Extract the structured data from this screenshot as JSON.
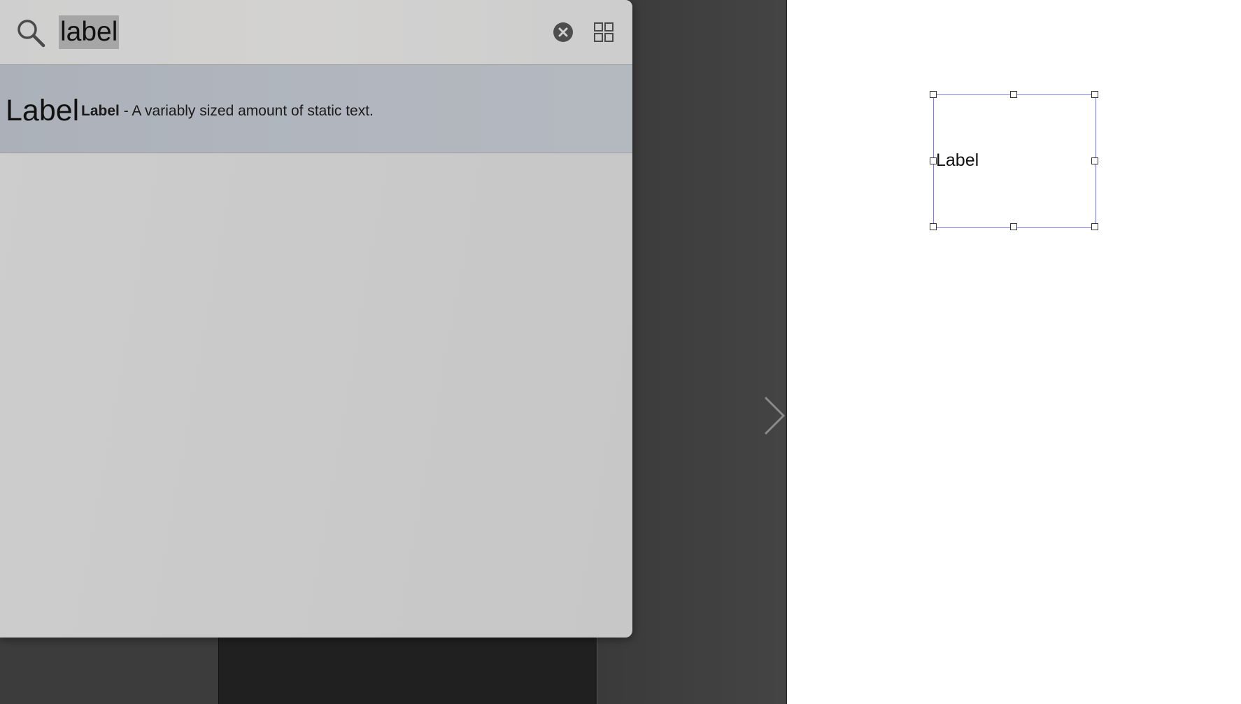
{
  "library": {
    "search": {
      "value": "label",
      "placeholder": ""
    },
    "icons": {
      "search": "search-icon",
      "clear": "clear-icon",
      "grid": "grid-view-icon"
    },
    "results": [
      {
        "preview": "Label",
        "name": "Label",
        "separator": " - ",
        "description": "A variably sized amount of static text."
      }
    ]
  },
  "canvas": {
    "label_text": "Label",
    "selection_color": "#7c7cf0"
  }
}
